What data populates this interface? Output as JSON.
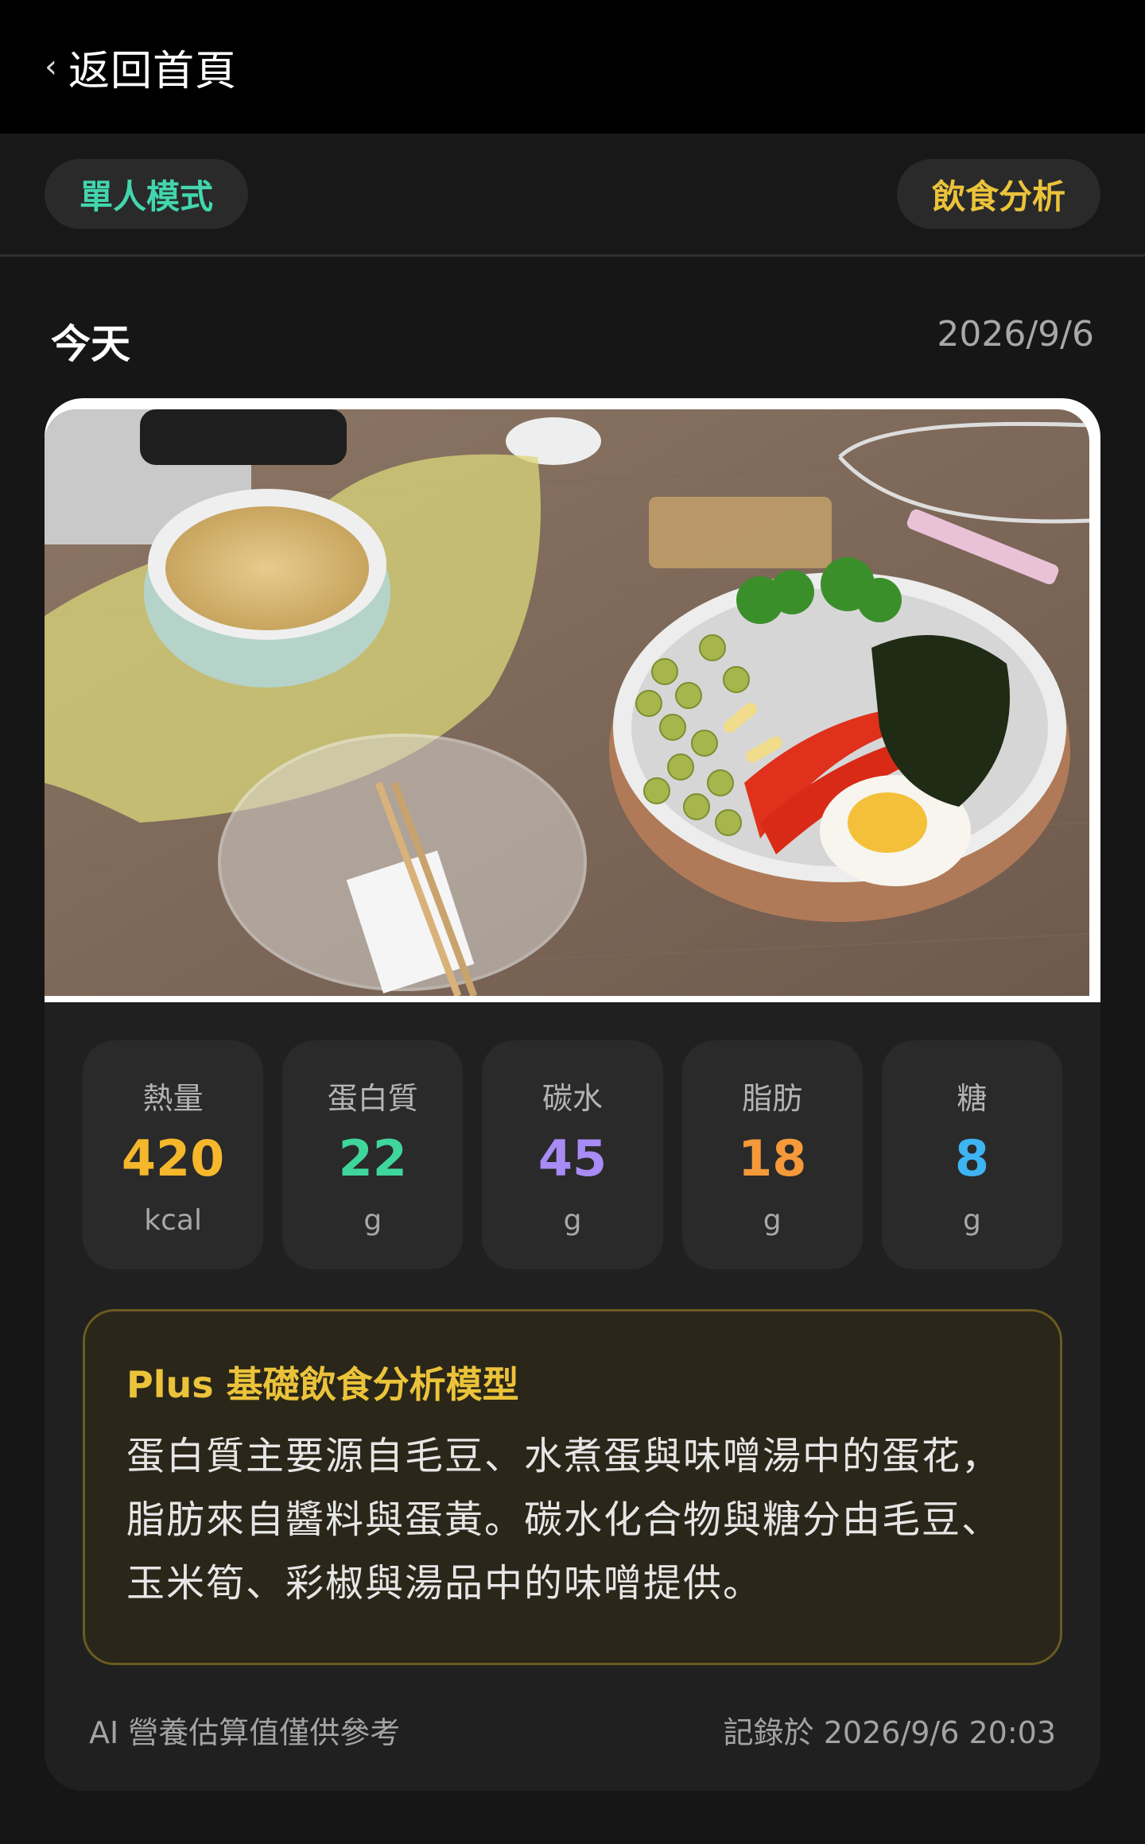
{
  "nav": {
    "back_label": "返回首頁"
  },
  "modes": {
    "single_label": "單人模式",
    "analysis_label": "飲食分析"
  },
  "day": {
    "title": "今天",
    "date": "2026/9/6"
  },
  "photo": {
    "description_icon": "meal-photo"
  },
  "stats": [
    {
      "label": "熱量",
      "value": "420",
      "unit": "kcal",
      "color": "#f5b72c"
    },
    {
      "label": "蛋白質",
      "value": "22",
      "unit": "g",
      "color": "#3fd69c"
    },
    {
      "label": "碳水",
      "value": "45",
      "unit": "g",
      "color": "#a88bf5"
    },
    {
      "label": "脂肪",
      "value": "18",
      "unit": "g",
      "color": "#f59a3a"
    },
    {
      "label": "糖",
      "value": "8",
      "unit": "g",
      "color": "#3fb4f2"
    }
  ],
  "analysis": {
    "title": "Plus 基礎飲食分析模型",
    "text": "蛋白質主要源自毛豆、水煮蛋與味噌湯中的蛋花，脂肪來自醬料與蛋黃。碳水化合物與糖分由毛豆、玉米筍、彩椒與湯品中的味噌提供。"
  },
  "footer": {
    "disclaimer": "AI 營養估算值僅供參考",
    "recorded": "記錄於 2026/9/6 20:03"
  }
}
